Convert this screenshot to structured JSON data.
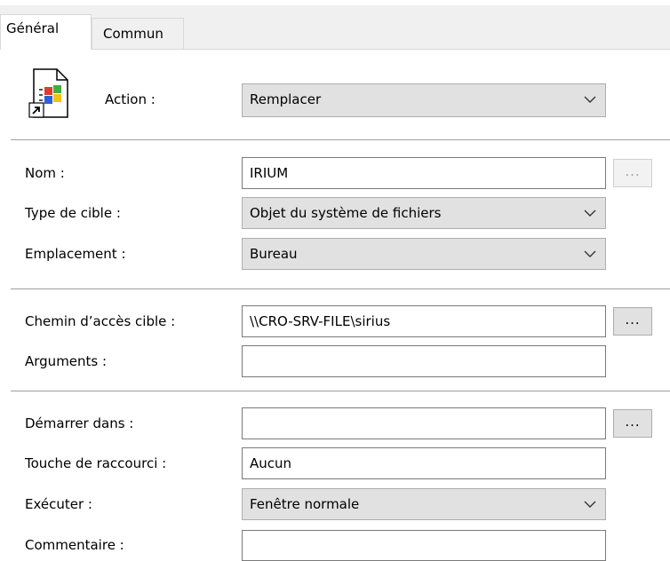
{
  "tabs": {
    "general": "Général",
    "commun": "Commun"
  },
  "action": {
    "label": "Action :",
    "value": "Remplacer"
  },
  "nom": {
    "label": "Nom :",
    "value": "IRIUM",
    "browse": "..."
  },
  "type_cible": {
    "label": "Type de cible :",
    "value": "Objet du système de fichiers"
  },
  "emplacement": {
    "label": "Emplacement :",
    "value": "Bureau"
  },
  "chemin": {
    "label": "Chemin d’accès cible :",
    "value": "\\\\CRO-SRV-FILE\\sirius",
    "browse": "..."
  },
  "arguments": {
    "label": "Arguments :",
    "value": ""
  },
  "demarrer": {
    "label": "Démarrer dans :",
    "value": "",
    "browse": "..."
  },
  "touche": {
    "label": "Touche de raccourci :",
    "value": "Aucun"
  },
  "executer": {
    "label": "Exécuter :",
    "value": "Fenêtre normale"
  },
  "commentaire": {
    "label": "Commentaire :",
    "value": ""
  }
}
